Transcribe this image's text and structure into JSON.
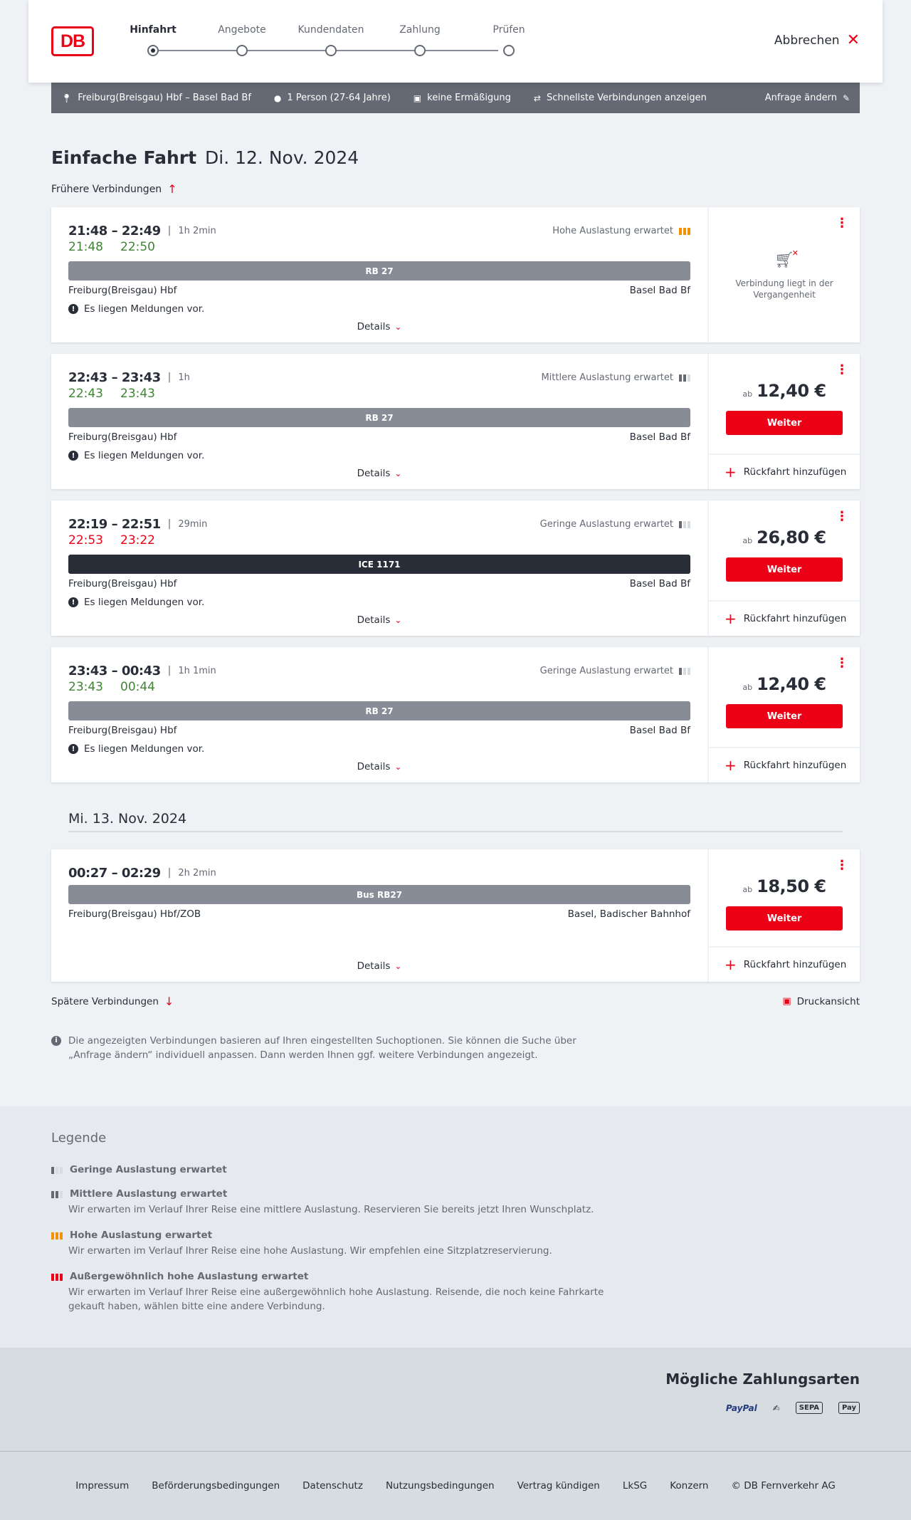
{
  "header": {
    "logo_text": "DB",
    "steps": [
      {
        "label": "Hinfahrt",
        "active": true
      },
      {
        "label": "Angebote",
        "active": false
      },
      {
        "label": "Kundendaten",
        "active": false
      },
      {
        "label": "Zahlung",
        "active": false
      },
      {
        "label": "Prüfen",
        "active": false
      }
    ],
    "cancel_label": "Abbrechen"
  },
  "summary": {
    "route": "Freiburg(Breisgau) Hbf – Basel Bad Bf",
    "passengers": "1 Person (27-64 Jahre)",
    "discount": "keine Ermäßigung",
    "fastest": "Schnellste Verbindungen anzeigen",
    "change": "Anfrage ändern"
  },
  "title": {
    "trip_type": "Einfache Fahrt",
    "date": "Di. 12. Nov. 2024"
  },
  "earlier_label": "Frühere Verbindungen",
  "later_label": "Spätere Verbindungen",
  "print_label": "Druckansicht",
  "connections": [
    {
      "times": "21:48 – 22:49",
      "duration": "1h 2min",
      "occupancy": "Hohe Auslastung erwartet",
      "rt_dep": "21:48",
      "rt_arr": "22:50",
      "train": "RB 27",
      "from": "Freiburg(Breisgau) Hbf",
      "to": "Basel Bad Bf",
      "notice": "Es liegen Meldungen vor.",
      "details": "Details",
      "past_text": "Verbindung liegt in der Vergangenheit"
    },
    {
      "times": "22:43 – 23:43",
      "duration": "1h",
      "occupancy": "Mittlere Auslastung erwartet",
      "rt_dep": "22:43",
      "rt_arr": "23:43",
      "train": "RB 27",
      "from": "Freiburg(Breisgau) Hbf",
      "to": "Basel Bad Bf",
      "notice": "Es liegen Meldungen vor.",
      "details": "Details",
      "price_prefix": "ab",
      "price": "12,40 €",
      "button": "Weiter",
      "return": "Rückfahrt hinzufügen"
    },
    {
      "times": "22:19 – 22:51",
      "duration": "29min",
      "occupancy": "Geringe Auslastung erwartet",
      "rt_dep": "22:53",
      "rt_arr": "23:22",
      "train": "ICE 1171",
      "from": "Freiburg(Breisgau) Hbf",
      "to": "Basel Bad Bf",
      "notice": "Es liegen Meldungen vor.",
      "details": "Details",
      "price_prefix": "ab",
      "price": "26,80 €",
      "button": "Weiter",
      "return": "Rückfahrt hinzufügen"
    },
    {
      "times": "23:43 – 00:43",
      "duration": "1h 1min",
      "occupancy": "Geringe Auslastung erwartet",
      "rt_dep": "23:43",
      "rt_arr": "00:44",
      "train": "RB 27",
      "from": "Freiburg(Breisgau) Hbf",
      "to": "Basel Bad Bf",
      "notice": "Es liegen Meldungen vor.",
      "details": "Details",
      "price_prefix": "ab",
      "price": "12,40 €",
      "button": "Weiter",
      "return": "Rückfahrt hinzufügen"
    }
  ],
  "day2": {
    "date": "Mi. 13. Nov. 2024",
    "connection": {
      "times": "00:27 – 02:29",
      "duration": "2h 2min",
      "train": "Bus RB27",
      "from": "Freiburg(Breisgau) Hbf/ZOB",
      "to": "Basel, Badischer Bahnhof",
      "details": "Details",
      "price_prefix": "ab",
      "price": "18,50 €",
      "button": "Weiter",
      "return": "Rückfahrt hinzufügen"
    }
  },
  "info_text": "Die angezeigten Verbindungen basieren auf Ihren eingestellten Suchoptionen. Sie können die Suche über „Anfrage ändern“ individuell anpassen. Dann werden Ihnen ggf. weitere Verbindungen angezeigt.",
  "legend": {
    "title": "Legende",
    "items": [
      {
        "title": "Geringe Auslastung erwartet",
        "desc": ""
      },
      {
        "title": "Mittlere Auslastung erwartet",
        "desc": "Wir erwarten im Verlauf Ihrer Reise eine mittlere Auslastung. Reservieren Sie bereits jetzt Ihren Wunschplatz."
      },
      {
        "title": "Hohe Auslastung erwartet",
        "desc": "Wir erwarten im Verlauf Ihrer Reise eine hohe Auslastung. Wir empfehlen eine Sitzplatzreservierung."
      },
      {
        "title": "Außergewöhnlich hohe Auslastung erwartet",
        "desc": "Wir erwarten im Verlauf Ihrer Reise eine außergewöhnlich hohe Auslastung. Reisende, die noch keine Fahrkarte gekauft haben, wählen bitte eine andere Verbindung."
      }
    ]
  },
  "payments": {
    "title": "Mögliche Zahlungsarten",
    "methods": [
      "PayPal",
      "SEPA",
      "Pay"
    ]
  },
  "footer": {
    "links": [
      "Impressum",
      "Beförderungsbedingungen",
      "Datenschutz",
      "Nutzungsbedingungen",
      "Vertrag kündigen",
      "LkSG",
      "Konzern",
      "© DB Fernverkehr AG"
    ]
  },
  "colors": {
    "brand_red": "#ec0016",
    "punctual_green": "#408335",
    "summary_bar": "#646973",
    "high_occupancy": "#f39200"
  }
}
